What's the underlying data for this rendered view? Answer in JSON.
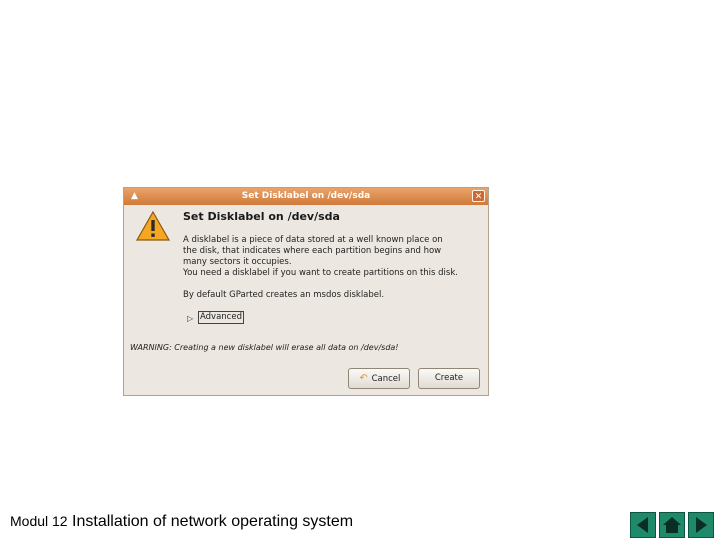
{
  "dialog": {
    "title": "Set Disklabel on /dev/sda",
    "heading": "Set Disklabel on /dev/sda",
    "description_lines": [
      "A disklabel is a piece of data stored at a well known place on",
      "the disk, that indicates where each partition begins and how",
      "many sectors it occupies.",
      "You need a disklabel if you want to create partitions on this disk."
    ],
    "default_text": "By default GParted creates an msdos disklabel.",
    "advanced_label": "Advanced",
    "warning_text": "WARNING: Creating a new disklabel will erase all data on /dev/sda!",
    "cancel_label": "Cancel",
    "create_label": "Create",
    "colors": {
      "titlebar": "#cf7a3a",
      "background": "#ece8e1"
    }
  },
  "footer": {
    "module": "Modul 12",
    "title": "Installation of network operating system"
  },
  "nav": {
    "prev_icon": "arrow-left-icon",
    "home_icon": "home-icon",
    "next_icon": "arrow-right-icon",
    "color": "#1e8a6a"
  }
}
